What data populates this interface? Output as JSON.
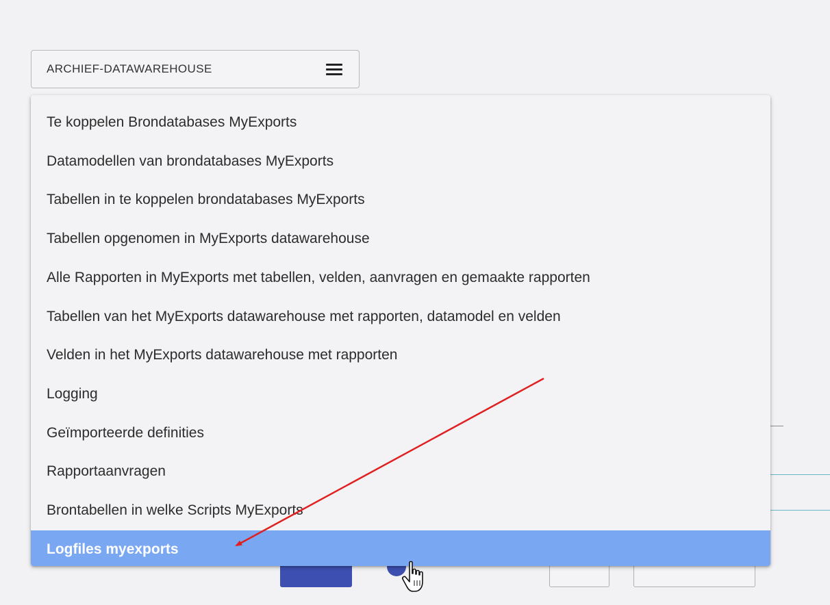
{
  "selector": {
    "label": "ARCHIEF-DATAWAREHOUSE",
    "icon": "menu-icon"
  },
  "menu": {
    "items": [
      {
        "label": "Te koppelen Brondatabases MyExports",
        "active": false
      },
      {
        "label": "Datamodellen van brondatabases MyExports",
        "active": false
      },
      {
        "label": "Tabellen in te koppelen brondatabases MyExports",
        "active": false
      },
      {
        "label": "Tabellen opgenomen in MyExports datawarehouse",
        "active": false
      },
      {
        "label": "Alle Rapporten in MyExports met tabellen, velden, aanvragen en gemaakte rapporten",
        "active": false
      },
      {
        "label": "Tabellen van het MyExports datawarehouse met rapporten, datamodel en velden",
        "active": false
      },
      {
        "label": "Velden in het MyExports datawarehouse met rapporten",
        "active": false
      },
      {
        "label": "Logging",
        "active": false
      },
      {
        "label": "Geïmporteerde definities",
        "active": false
      },
      {
        "label": "Rapportaanvragen",
        "active": false
      },
      {
        "label": "Brontabellen in welke Scripts MyExports",
        "active": false
      },
      {
        "label": "Logfiles myexports",
        "active": true
      }
    ]
  },
  "annotation": {
    "arrow_color": "#e02020",
    "cursor": "hand-pointer-icon"
  },
  "colors": {
    "active_item_bg": "#7aa7f2",
    "primary_button": "#3d4fb0"
  }
}
